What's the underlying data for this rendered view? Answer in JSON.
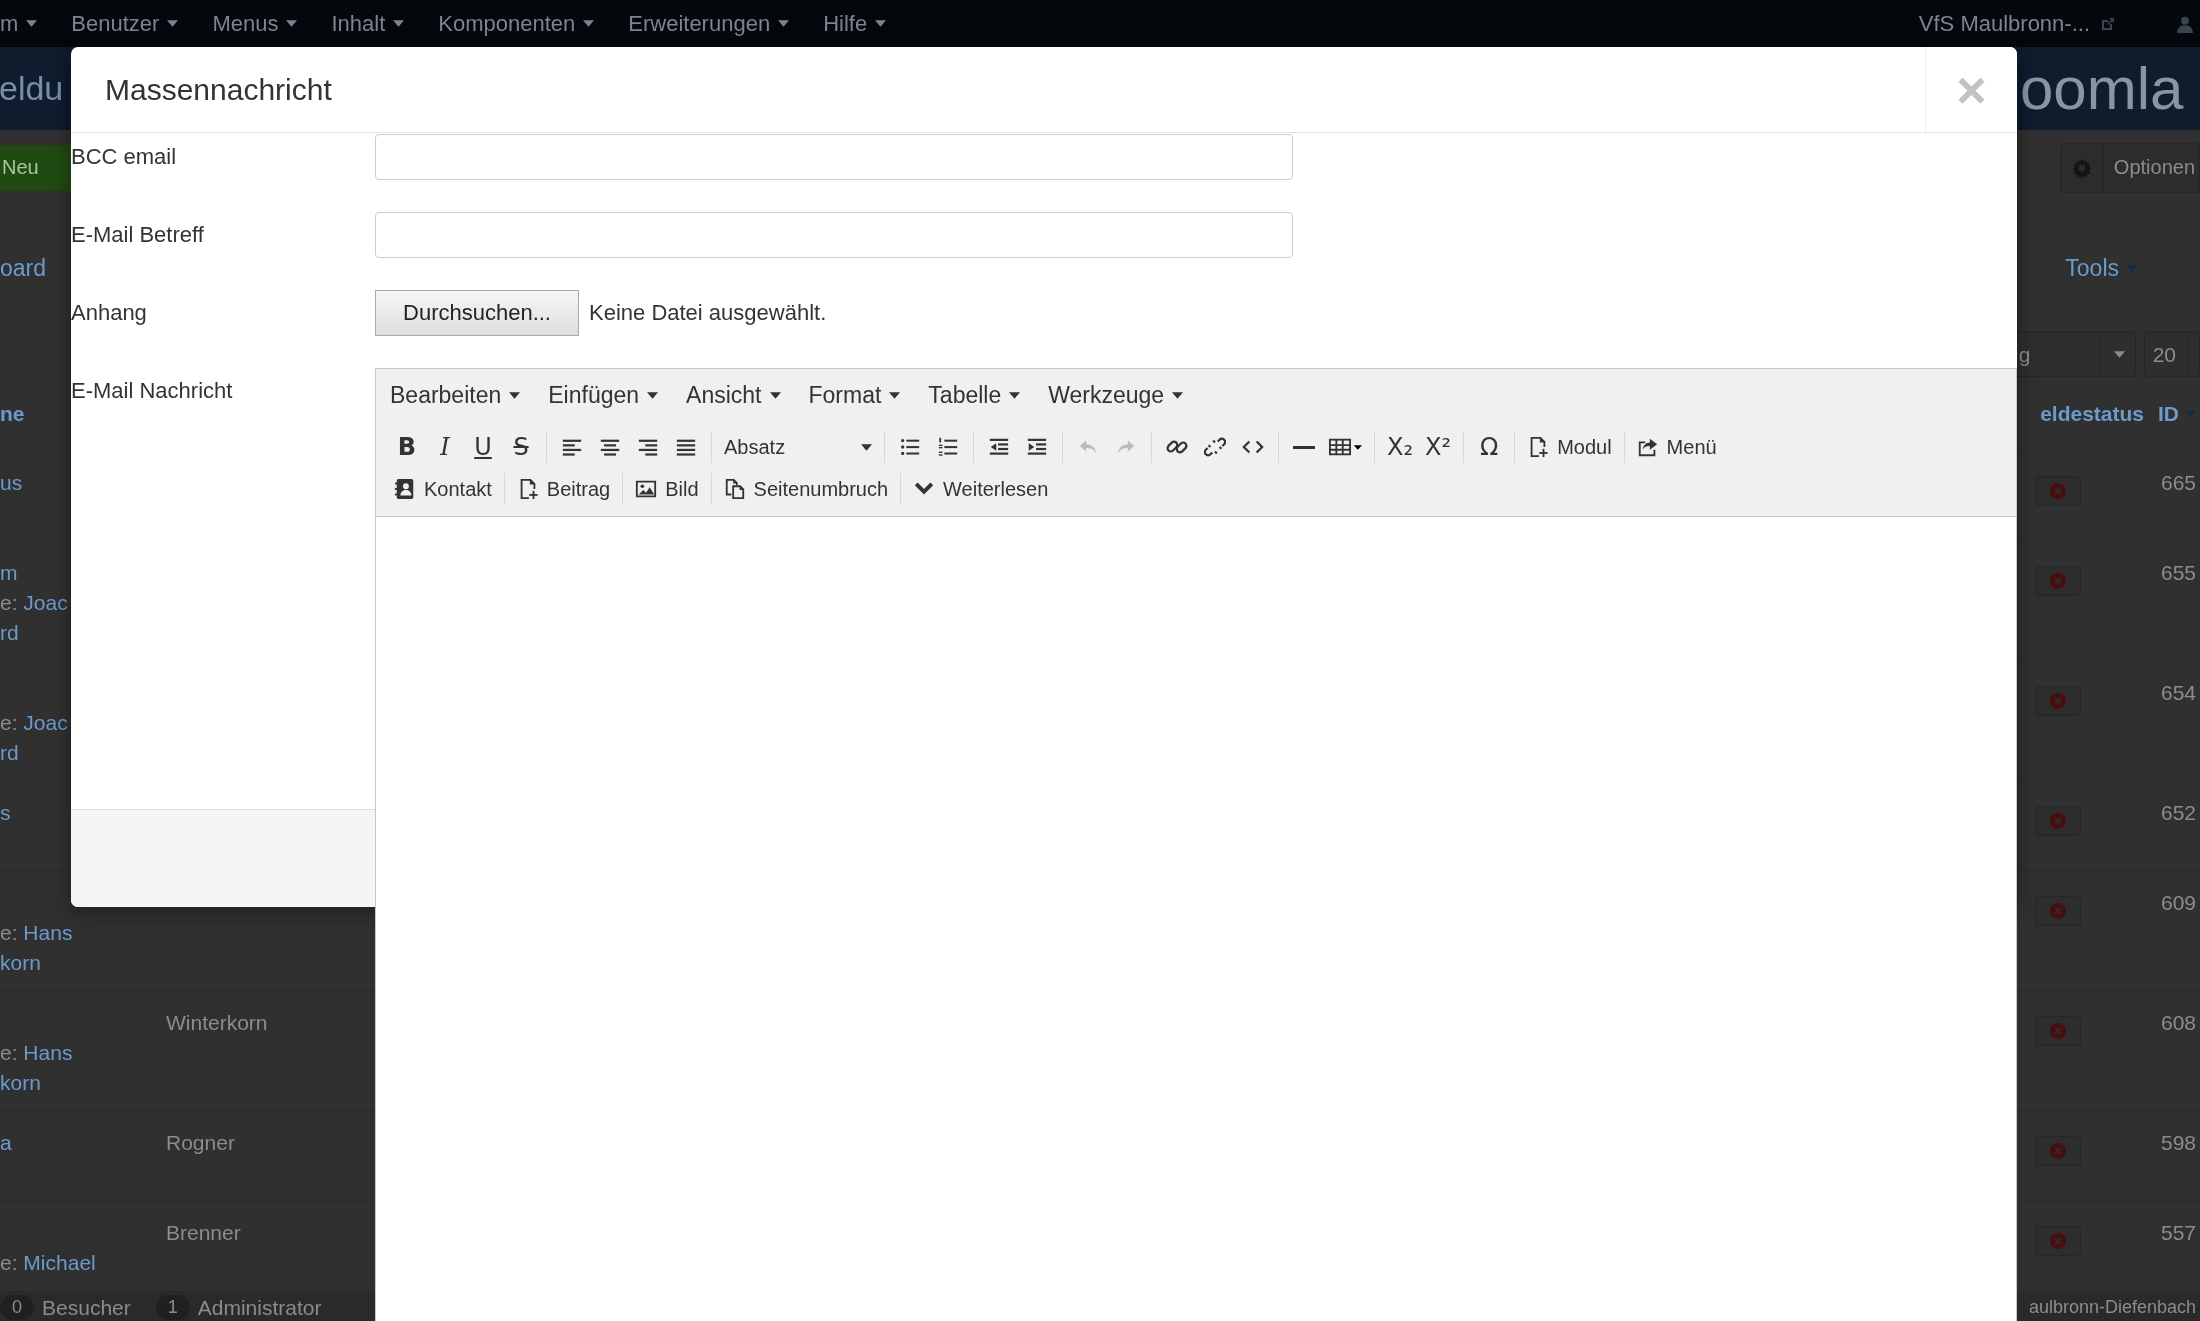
{
  "backdrop": {
    "nav": {
      "menus": [
        "m",
        "Benutzer",
        "Menus",
        "Inhalt",
        "Komponenten",
        "Erweiterungen",
        "Hilfe"
      ],
      "site": "VfS Maulbronn-..."
    },
    "header": {
      "title": "eldu",
      "logo": "oomla"
    },
    "toolbar": {
      "new_button": "Neu",
      "options_button": "Optionen"
    },
    "subnav": {
      "link": "oard",
      "tools": "Tools"
    },
    "filters": {
      "state": "g",
      "limit": "20"
    },
    "columns": [
      "ne",
      "eldestatus",
      "ID"
    ],
    "rows": [
      {
        "name": "us",
        "id": "665"
      },
      {
        "name": "m",
        "notes": [
          {
            "prefix": "e:",
            "link": "Joac"
          },
          {
            "link": "rd"
          }
        ],
        "id": "655"
      },
      {
        "notes": [
          {
            "prefix": "e:",
            "link": "Joac"
          },
          {
            "link": "rd"
          }
        ],
        "id": "654"
      },
      {
        "name": "s",
        "id": "652"
      },
      {
        "notes": [
          {
            "prefix": "e:",
            "link": "Hans"
          },
          {
            "link": "korn"
          }
        ],
        "id": "609"
      },
      {
        "surname": "Winterkorn",
        "notes": [
          {
            "prefix": "e:",
            "link": "Hans"
          },
          {
            "link": "korn"
          }
        ],
        "id": "608"
      },
      {
        "name": "a",
        "surname": "Rogner",
        "id": "598"
      },
      {
        "surname": "Brenner",
        "notes": [
          {
            "prefix": "e:",
            "link": "Michael"
          }
        ],
        "id": "557"
      }
    ],
    "footer": {
      "badges": [
        {
          "count": "0",
          "label": "Besucher"
        },
        {
          "count": "1",
          "label": "Administrator"
        }
      ],
      "site": "aulbronn-Diefenbach"
    }
  },
  "modal": {
    "title": "Massennachricht",
    "close": "×",
    "fields": [
      {
        "kind": "text",
        "label": "BCC email"
      },
      {
        "kind": "text",
        "label": "E-Mail Betreff"
      },
      {
        "kind": "file",
        "label": "Anhang",
        "button": "Durchsuchen...",
        "status": "Keine Datei ausgewählt."
      },
      {
        "kind": "editor",
        "label": "E-Mail Nachricht"
      }
    ],
    "editor": {
      "menus": [
        "Bearbeiten",
        "Einfügen",
        "Ansicht",
        "Format",
        "Tabelle",
        "Werkzeuge"
      ],
      "toolbar_rows": [
        [
          [
            {
              "kind": "bold",
              "glyph": "B",
              "disabled": false
            },
            {
              "kind": "italic",
              "glyph": "I",
              "disabled": false
            },
            {
              "kind": "underline",
              "glyph": "U",
              "disabled": false
            },
            {
              "kind": "strike",
              "glyph": "S",
              "disabled": false
            }
          ],
          [
            {
              "kind": "align-left",
              "disabled": false
            },
            {
              "kind": "align-center",
              "disabled": false
            },
            {
              "kind": "align-right",
              "disabled": false
            },
            {
              "kind": "justify",
              "disabled": false
            }
          ],
          [
            {
              "kind": "select",
              "value": "Absatz",
              "disabled": false
            }
          ],
          [
            {
              "kind": "bullet-list",
              "disabled": false
            },
            {
              "kind": "number-list",
              "disabled": false
            }
          ],
          [
            {
              "kind": "outdent",
              "disabled": false
            },
            {
              "kind": "indent",
              "disabled": false
            }
          ],
          [
            {
              "kind": "undo",
              "disabled": true
            },
            {
              "kind": "redo",
              "disabled": true
            }
          ],
          [
            {
              "kind": "link",
              "disabled": false
            },
            {
              "kind": "unlink",
              "disabled": false
            },
            {
              "kind": "code",
              "disabled": false
            }
          ],
          [
            {
              "kind": "hr",
              "disabled": false
            },
            {
              "kind": "table",
              "disabled": false
            }
          ],
          [
            {
              "kind": "subscript",
              "glyph": "X₂",
              "disabled": false
            },
            {
              "kind": "superscript",
              "glyph": "X²",
              "disabled": false
            }
          ],
          [
            {
              "kind": "omega",
              "glyph": "Ω",
              "disabled": false
            }
          ],
          [
            {
              "kind": "module",
              "label": "Modul",
              "disabled": false
            }
          ],
          [
            {
              "kind": "menu",
              "label": "Menü",
              "disabled": false
            }
          ]
        ],
        [
          [
            {
              "kind": "contact",
              "label": "Kontakt",
              "disabled": false
            }
          ],
          [
            {
              "kind": "article",
              "label": "Beitrag",
              "disabled": false
            }
          ],
          [
            {
              "kind": "image",
              "label": "Bild",
              "disabled": false
            }
          ],
          [
            {
              "kind": "pagebreak",
              "label": "Seitenumbruch",
              "disabled": false
            }
          ],
          [
            {
              "kind": "readmore",
              "label": "Weiterlesen",
              "disabled": false
            }
          ]
        ]
      ]
    }
  }
}
